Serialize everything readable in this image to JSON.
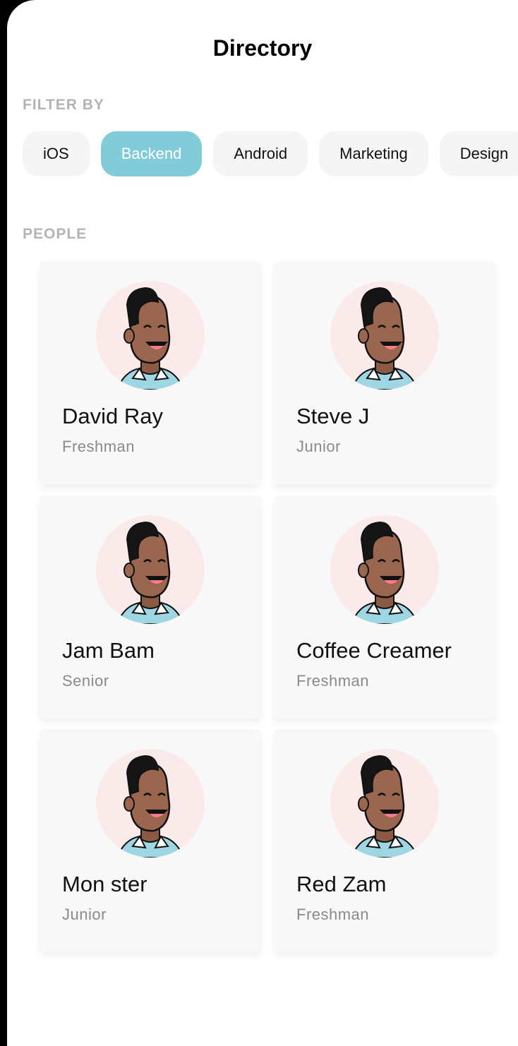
{
  "header": {
    "title": "Directory"
  },
  "filter": {
    "label": "FILTER BY",
    "chips": [
      "iOS",
      "Backend",
      "Android",
      "Marketing",
      "Design"
    ],
    "active": "Backend"
  },
  "people": {
    "label": "PEOPLE",
    "cards": [
      {
        "name": "David Ray",
        "class_year": "Freshman"
      },
      {
        "name": "Steve J",
        "class_year": "Junior"
      },
      {
        "name": "Jam Bam",
        "class_year": "Senior"
      },
      {
        "name": "Coffee Creamer",
        "class_year": "Freshman"
      },
      {
        "name": "Mon ster",
        "class_year": "Junior"
      },
      {
        "name": "Red Zam",
        "class_year": "Freshman"
      }
    ]
  },
  "colors": {
    "accent": "#82cbd8",
    "chip_bg": "#f5f5f5",
    "card_bg": "#f8f8f8",
    "avatar_bg": "#fbeaea"
  }
}
